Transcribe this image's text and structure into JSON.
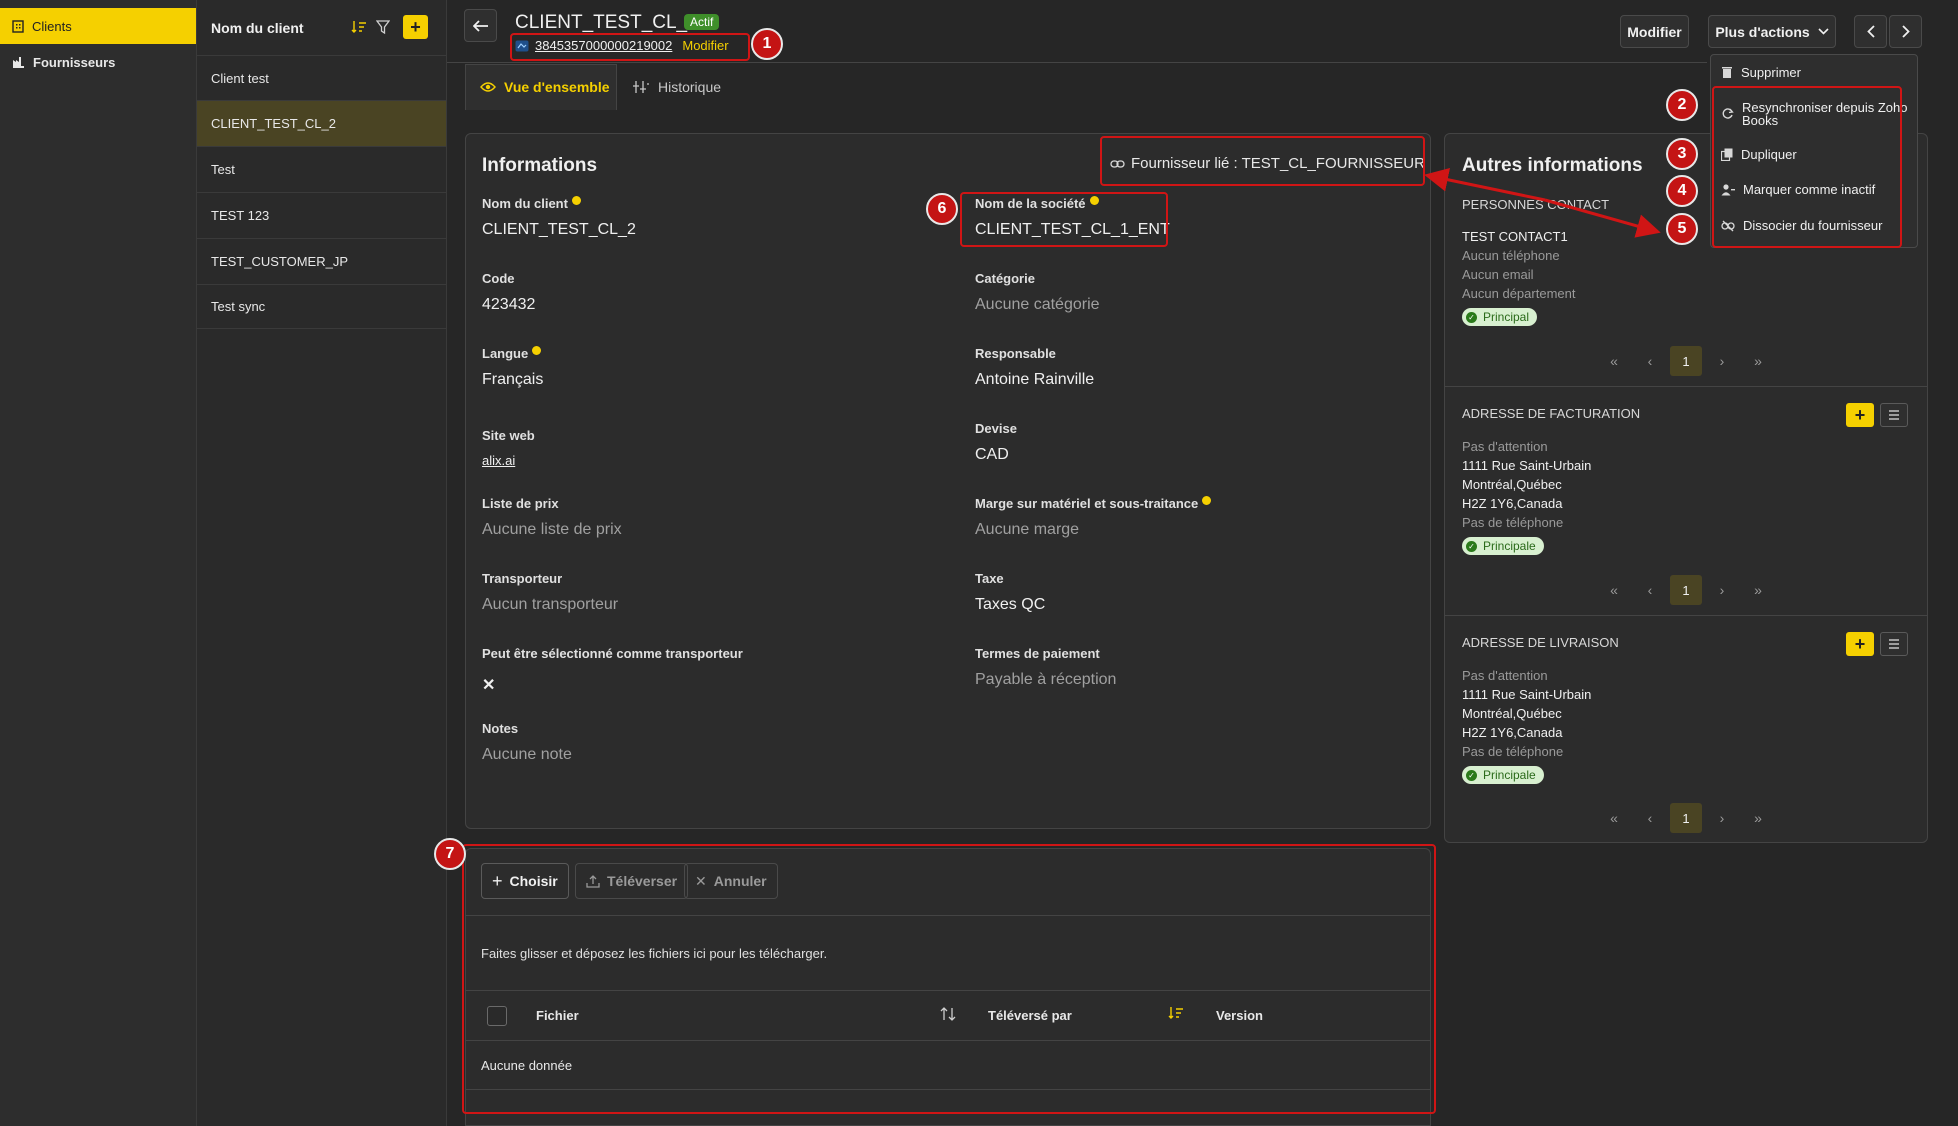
{
  "nav": {
    "items": [
      {
        "label": "Clients",
        "icon": "building-icon"
      },
      {
        "label": "Fournisseurs",
        "icon": "factory-icon"
      }
    ]
  },
  "list": {
    "header": "Nom du client",
    "rows": [
      "Client test",
      "CLIENT_TEST_CL_2",
      "Test",
      "TEST 123",
      "TEST_CUSTOMER_JP",
      "Test sync"
    ],
    "selected": "CLIENT_TEST_CL_2"
  },
  "header": {
    "title": "CLIENT_TEST_CL_2",
    "status": "Actif",
    "zoho_id": "3845357000000219002",
    "zoho_edit": "Modifier",
    "edit_button": "Modifier",
    "more_actions": "Plus d'actions"
  },
  "tabs": [
    {
      "label": "Vue d'ensemble",
      "active": true
    },
    {
      "label": "Historique",
      "active": false
    }
  ],
  "dropdown": {
    "items": [
      "Supprimer",
      "Resynchroniser depuis Zoho Books",
      "Dupliquer",
      "Marquer comme inactif",
      "Dissocier du fournisseur"
    ]
  },
  "info": {
    "title": "Informations",
    "linked_supplier": "Fournisseur lié : TEST_CL_FOURNISSEUR",
    "left": [
      {
        "label": "Nom du client",
        "value": "CLIENT_TEST_CL_2",
        "hint": true
      },
      {
        "label": "Code",
        "value": "423432"
      },
      {
        "label": "Langue",
        "value": "Français",
        "hint": true
      },
      {
        "label": "Site web",
        "value": "alix.ai"
      },
      {
        "label": "Liste de prix",
        "value": "Aucune liste de prix"
      },
      {
        "label": "Transporteur",
        "value": "Aucun transporteur"
      },
      {
        "label": "Peut être sélectionné comme transporteur",
        "value": "✕"
      },
      {
        "label": "Notes",
        "value": "Aucune note"
      }
    ],
    "right": [
      {
        "label": "Nom de la société",
        "value": "CLIENT_TEST_CL_1_ENT",
        "hint": true
      },
      {
        "label": "Catégorie",
        "value": "Aucune catégorie"
      },
      {
        "label": "Responsable",
        "value": "Antoine Rainville"
      },
      {
        "label": "Devise",
        "value": "CAD"
      },
      {
        "label": "Marge sur matériel et sous-traitance",
        "value": "Aucune marge",
        "hint": true
      },
      {
        "label": "Taxe",
        "value": "Taxes QC"
      },
      {
        "label": "Termes de paiement",
        "value": "Payable à réception"
      }
    ]
  },
  "other": {
    "title": "Autres informations",
    "contacts": {
      "title": "PERSONNES CONTACT",
      "name": "TEST CONTACT1",
      "phone": "Aucun téléphone",
      "email": "Aucun email",
      "department": "Aucun département",
      "badge": "Principal",
      "page": "1"
    },
    "billing": {
      "title": "ADRESSE DE FACTURATION",
      "attention": "Pas d'attention",
      "line1": "1111 Rue Saint-Urbain",
      "line2": "Montréal,Québec",
      "line3": "H2Z 1Y6,Canada",
      "phone": "Pas de téléphone",
      "badge": "Principale",
      "page": "1"
    },
    "shipping": {
      "title": "ADRESSE DE LIVRAISON",
      "attention": "Pas d'attention",
      "line1": "1111 Rue Saint-Urbain",
      "line2": "Montréal,Québec",
      "line3": "H2Z 1Y6,Canada",
      "phone": "Pas de téléphone",
      "badge": "Principale",
      "page": "1"
    },
    "pager": {
      "first": "«",
      "prev": "‹",
      "next": "›",
      "last": "»"
    }
  },
  "upload": {
    "choose": "Choisir",
    "upload": "Téléverser",
    "cancel": "Annuler",
    "drop_hint": "Faites glisser et déposez les fichiers ici pour les télécharger.",
    "columns": [
      "Fichier",
      "Téléversé par",
      "Version"
    ],
    "empty": "Aucune donnée"
  },
  "annotations": [
    "1",
    "2",
    "3",
    "4",
    "5",
    "6",
    "7"
  ],
  "colors": {
    "accent": "#f5d000",
    "annotation": "#d01515",
    "status": "#3f8f2a"
  }
}
